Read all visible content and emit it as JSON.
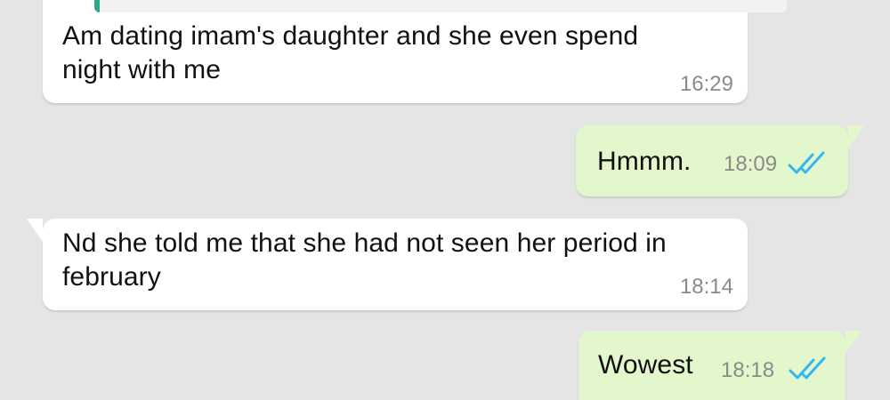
{
  "messages": [
    {
      "direction": "incoming",
      "text": "Am dating imam's daughter and she even spend\nnight with me",
      "time": "16:29",
      "has_quote": true
    },
    {
      "direction": "outgoing",
      "text": "Hmmm.",
      "time": "18:09",
      "status": "read"
    },
    {
      "direction": "incoming",
      "text": "Nd she told me that she had not seen her period in\nfebruary",
      "time": "18:14"
    },
    {
      "direction": "outgoing",
      "text": "Wowest",
      "time": "18:18",
      "status": "read"
    }
  ],
  "colors": {
    "background": "#e5e5e5",
    "incoming_bubble": "#ffffff",
    "outgoing_bubble": "#e2f7cb",
    "read_ticks": "#34b7f1",
    "quote_accent": "#2ea58f",
    "timestamp": "#8a8a8a"
  },
  "icons": {
    "read_status": "double-check-icon"
  }
}
